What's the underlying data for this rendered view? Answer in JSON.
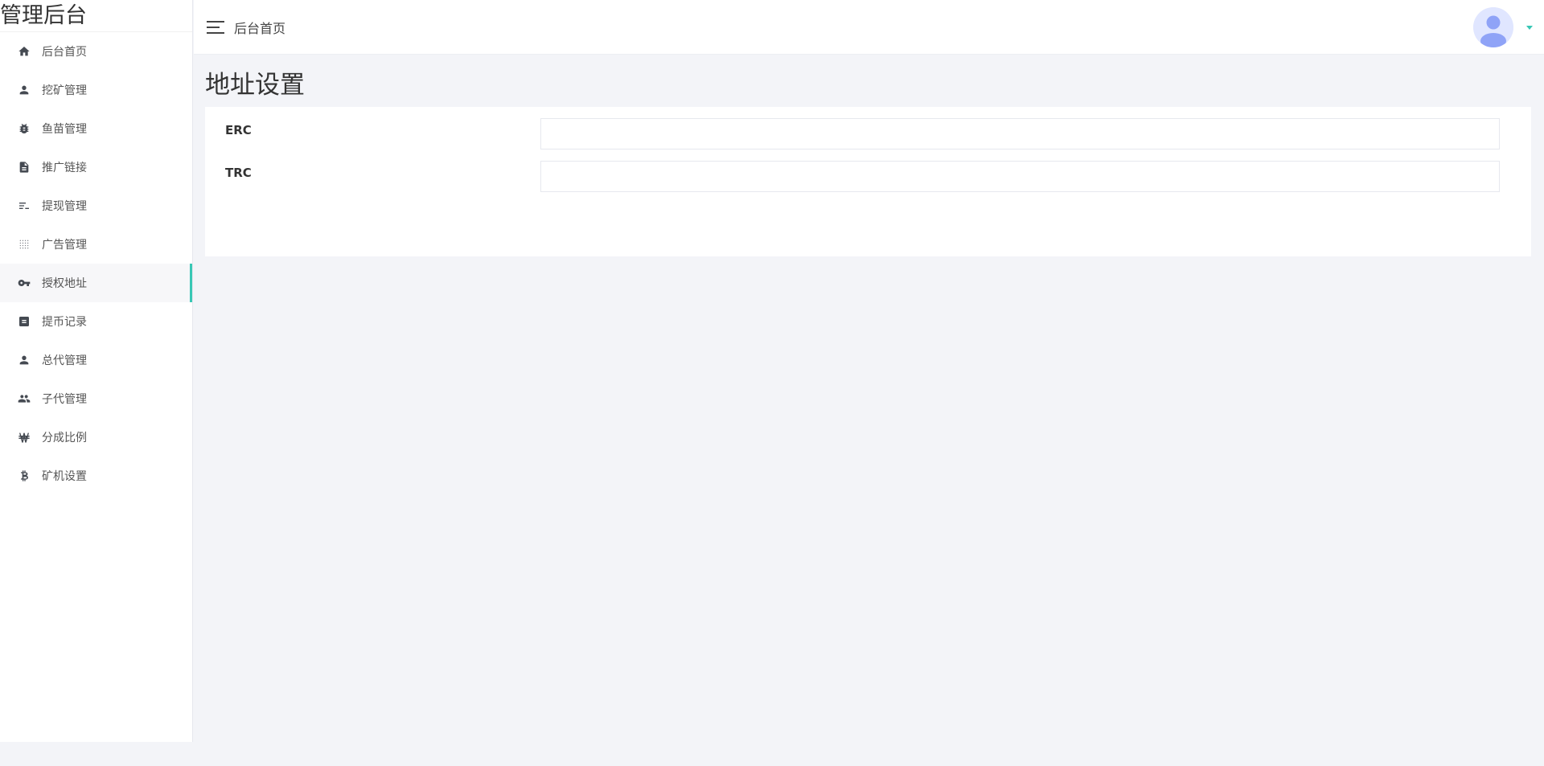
{
  "sidebar": {
    "brand": "管理后台",
    "items": [
      {
        "label": "后台首页",
        "icon": "home-icon"
      },
      {
        "label": "挖矿管理",
        "icon": "person-icon"
      },
      {
        "label": "鱼苗管理",
        "icon": "bug-icon"
      },
      {
        "label": "推广链接",
        "icon": "document-icon"
      },
      {
        "label": "提现管理",
        "icon": "list-icon"
      },
      {
        "label": "广告管理",
        "icon": "grid-dots-icon"
      },
      {
        "label": "授权地址",
        "icon": "key-icon",
        "active": true
      },
      {
        "label": "提币记录",
        "icon": "note-icon"
      },
      {
        "label": "总代管理",
        "icon": "person-icon"
      },
      {
        "label": "子代管理",
        "icon": "people-icon"
      },
      {
        "label": "分成比例",
        "icon": "won-icon"
      },
      {
        "label": "矿机设置",
        "icon": "bitcoin-icon"
      }
    ]
  },
  "header": {
    "title": "后台首页"
  },
  "main": {
    "page_title": "地址设置",
    "fields": [
      {
        "label": "ERC",
        "value": "",
        "placeholder": ""
      },
      {
        "label": "TRC",
        "value": "",
        "placeholder": ""
      }
    ]
  },
  "colors": {
    "accent": "#38c7b5",
    "background": "#f3f4f8",
    "avatar": "#8fa3f7"
  }
}
